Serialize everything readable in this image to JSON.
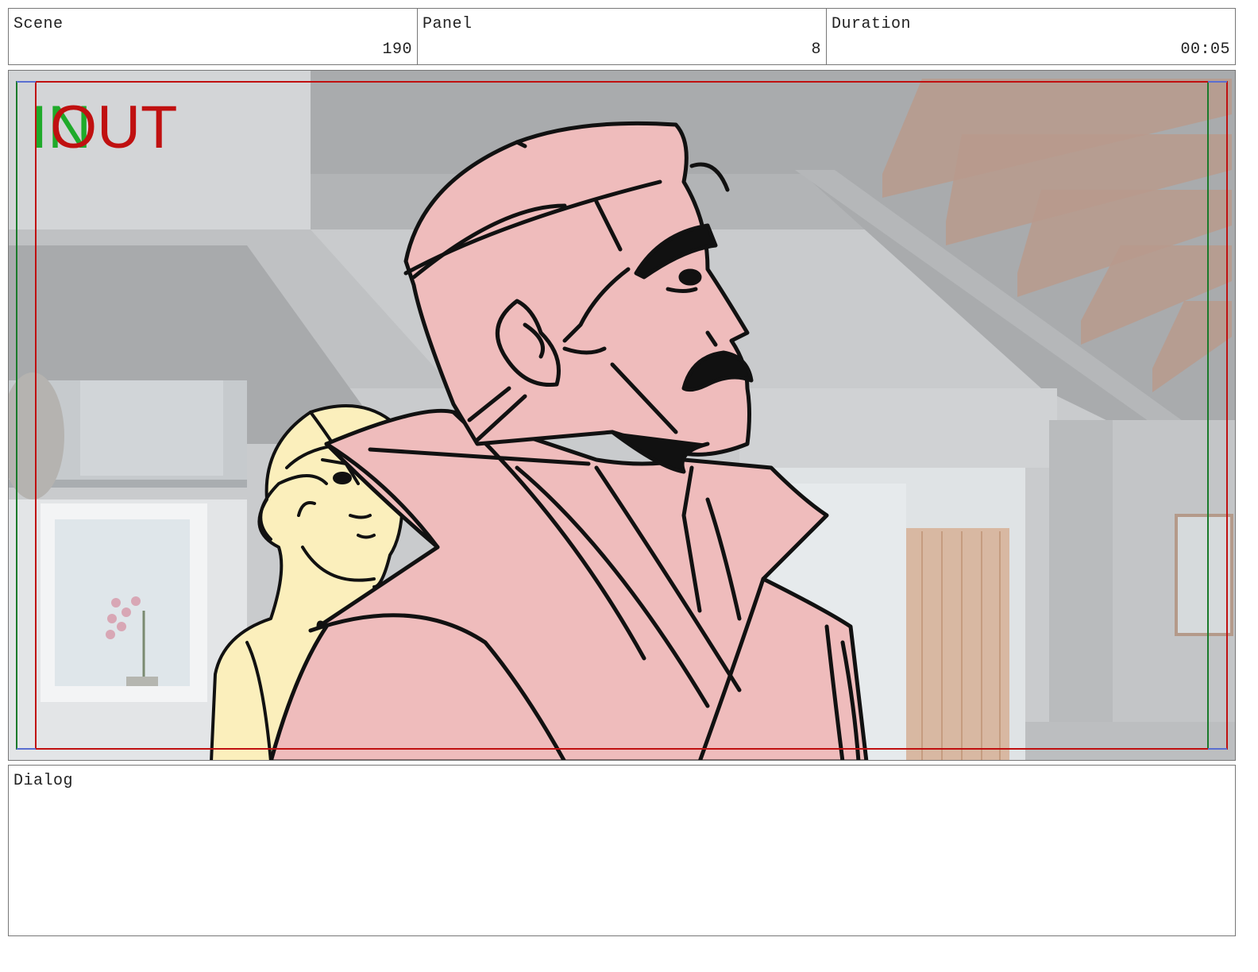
{
  "header": {
    "scene": {
      "label": "Scene",
      "value": "190"
    },
    "panel": {
      "label": "Panel",
      "value": "8"
    },
    "duration": {
      "label": "Duration",
      "value": "00:05"
    }
  },
  "frame": {
    "in_label": "IN",
    "out_label": "OUT",
    "colors": {
      "in": "#1faa2a",
      "out": "#c01010",
      "man_fill": "#efbcbc",
      "woman_fill": "#fbefbc",
      "background_tone": "#c4c7ca"
    }
  },
  "dialog": {
    "label": "Dialog",
    "text": ""
  }
}
